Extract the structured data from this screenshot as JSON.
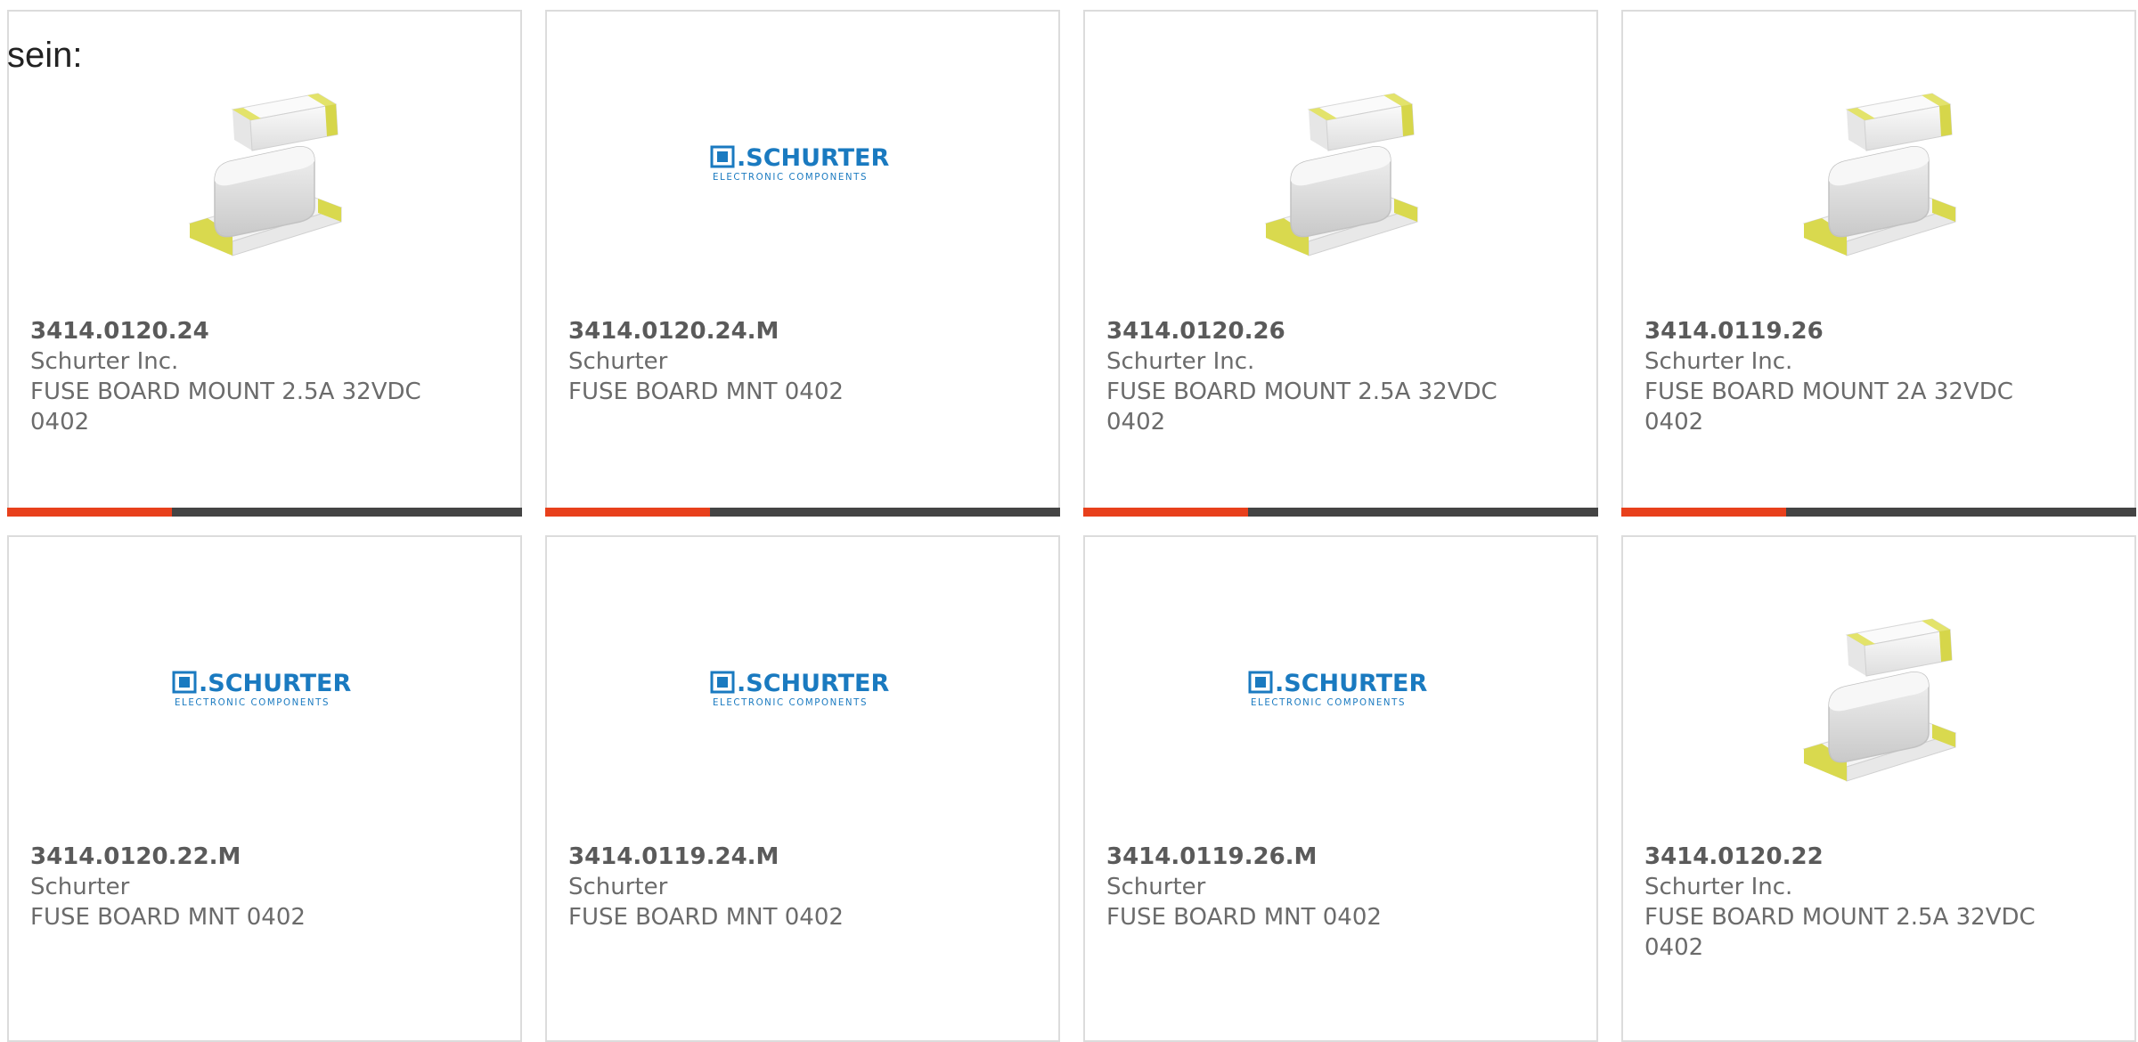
{
  "intro": "sein:",
  "colors": {
    "accent": "#e8401c",
    "bar": "#444444",
    "border": "#dcdcdc",
    "brand": "#1a7ac0"
  },
  "cards": [
    {
      "part": "3414.0120.24",
      "manufacturer": "Schurter Inc.",
      "desc": "FUSE BOARD MOUNT 2.5A 32VDC",
      "desc2": "0402",
      "image": "fuse-product",
      "progress": 0.32
    },
    {
      "part": "3414.0120.24.M",
      "manufacturer": "Schurter",
      "desc": "FUSE BOARD MNT 0402",
      "desc2": "",
      "image": "schurter-logo",
      "progress": 0.32
    },
    {
      "part": "3414.0120.26",
      "manufacturer": "Schurter Inc.",
      "desc": "FUSE BOARD MOUNT 2.5A 32VDC",
      "desc2": "0402",
      "image": "fuse-product",
      "progress": 0.32
    },
    {
      "part": "3414.0119.26",
      "manufacturer": "Schurter Inc.",
      "desc": "FUSE BOARD MOUNT 2A 32VDC",
      "desc2": "0402",
      "image": "fuse-product",
      "progress": 0.32
    },
    {
      "part": "3414.0120.22.M",
      "manufacturer": "Schurter",
      "desc": "FUSE BOARD MNT 0402",
      "desc2": "",
      "image": "schurter-logo"
    },
    {
      "part": "3414.0119.24.M",
      "manufacturer": "Schurter",
      "desc": "FUSE BOARD MNT 0402",
      "desc2": "",
      "image": "schurter-logo"
    },
    {
      "part": "3414.0119.26.M",
      "manufacturer": "Schurter",
      "desc": "FUSE BOARD MNT 0402",
      "desc2": "",
      "image": "schurter-logo"
    },
    {
      "part": "3414.0120.22",
      "manufacturer": "Schurter Inc.",
      "desc": "FUSE BOARD MOUNT 2.5A 32VDC",
      "desc2": "0402",
      "image": "fuse-product"
    }
  ],
  "logo": {
    "name": "SCHURTER",
    "tagline": "ELECTRONIC COMPONENTS"
  }
}
